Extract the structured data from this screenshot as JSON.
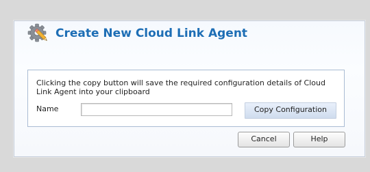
{
  "dialog": {
    "title": "Create New Cloud Link Agent",
    "title_icon": "gear-pencil-icon",
    "description": "Clicking the copy button will save the required configuration details of Cloud Link Agent into your clipboard",
    "name_label": "Name",
    "name_value": "",
    "copy_button_label": "Copy Configuration",
    "cancel_button_label": "Cancel",
    "help_button_label": "Help"
  },
  "colors": {
    "title": "#1e6eb5",
    "panel_border": "#a9bbd3",
    "background": "#d9d9d9"
  }
}
